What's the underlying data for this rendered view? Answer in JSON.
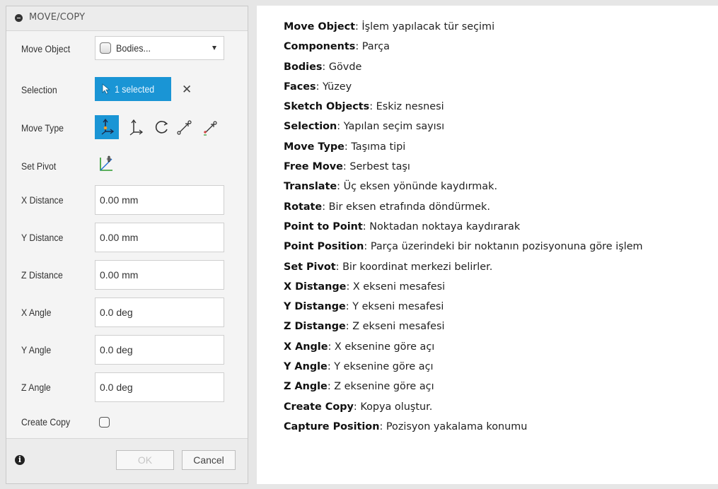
{
  "dialog": {
    "title": "MOVE/COPY",
    "move_object": {
      "label": "Move Object",
      "value": "Bodies..."
    },
    "selection": {
      "label": "Selection",
      "value": "1 selected"
    },
    "move_type": {
      "label": "Move Type",
      "icons": [
        "free-move-icon",
        "translate-icon",
        "rotate-icon",
        "point-to-point-icon",
        "point-position-icon"
      ]
    },
    "set_pivot": {
      "label": "Set Pivot"
    },
    "fields": [
      {
        "label": "X Distance",
        "value": "0.00 mm"
      },
      {
        "label": "Y Distance",
        "value": "0.00 mm"
      },
      {
        "label": "Z Distance",
        "value": "0.00 mm"
      },
      {
        "label": "X Angle",
        "value": "0.0 deg"
      },
      {
        "label": "Y Angle",
        "value": "0.0 deg"
      },
      {
        "label": "Z Angle",
        "value": "0.0 deg"
      }
    ],
    "create_copy": {
      "label": "Create Copy",
      "checked": false
    },
    "ok_label": "OK",
    "cancel_label": "Cancel",
    "accent_color": "#1a95d5"
  },
  "descriptions": [
    {
      "term": "Move Object",
      "text": ": İşlem yapılacak tür seçimi"
    },
    {
      "term": "Components",
      "text": ": Parça"
    },
    {
      "term": "Bodies",
      "text": ": Gövde"
    },
    {
      "term": "Faces",
      "text": ": Yüzey"
    },
    {
      "term": "Sketch Objects",
      "text": ": Eskiz nesnesi"
    },
    {
      "term": "Selection",
      "text": ": Yapılan seçim sayısı"
    },
    {
      "term": "Move Type",
      "text": ": Taşıma tipi"
    },
    {
      "term": "Free Move",
      "text": ": Serbest taşı"
    },
    {
      "term": "Translate",
      "text": ": Üç eksen yönünde kaydırmak."
    },
    {
      "term": "Rotate",
      "text": ": Bir eksen etrafında döndürmek."
    },
    {
      "term": "Point to Point",
      "text": ": Noktadan noktaya kaydırarak"
    },
    {
      "term": "Point Position",
      "text": ": Parça üzerindeki bir noktanın pozisyonuna göre işlem"
    },
    {
      "term": "Set Pivot",
      "text": ": Bir koordinat merkezi belirler."
    },
    {
      "term": "X Distange",
      "text": ": X ekseni mesafesi"
    },
    {
      "term": "Y Distange",
      "text": ": Y ekseni mesafesi"
    },
    {
      "term": "Z Distange",
      "text": ": Z ekseni mesafesi"
    },
    {
      "term": "X Angle",
      "text": ": X eksenine göre açı"
    },
    {
      "term": "Y Angle",
      "text": ": Y eksenine göre açı"
    },
    {
      "term": "Z Angle",
      "text": ": Z eksenine göre açı"
    },
    {
      "term": "Create Copy",
      "text": ": Kopya oluştur."
    },
    {
      "term": "Capture Position",
      "text": ": Pozisyon yakalama konumu"
    }
  ]
}
